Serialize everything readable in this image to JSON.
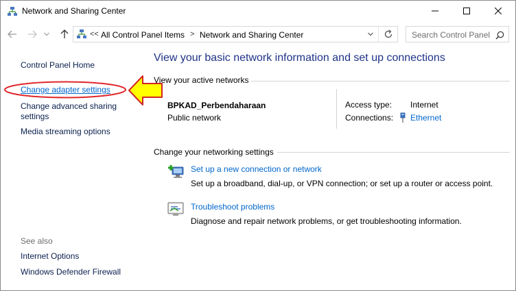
{
  "window": {
    "title": "Network and Sharing Center",
    "icon": "network-center-icon",
    "controls": [
      "minimize-icon",
      "maximize-icon",
      "close-icon"
    ]
  },
  "navigation": {
    "breadcrumb_overflow": "<<",
    "breadcrumb": [
      "All Control Panel Items",
      "Network and Sharing Center"
    ],
    "breadcrumb_separator": ">",
    "search_placeholder": "Search Control Panel"
  },
  "sidebar": {
    "home": "Control Panel Home",
    "links": [
      "Change adapter settings",
      "Change advanced sharing settings",
      "Media streaming options"
    ],
    "see_also_label": "See also",
    "see_also": [
      "Internet Options",
      "Windows Defender Firewall"
    ],
    "annotation_colors": {
      "ellipse": "#e0262a",
      "arrow_fill": "#ffff00",
      "arrow_stroke": "#d12424"
    }
  },
  "main": {
    "heading": "View your basic network information and set up connections",
    "active_networks_label": "View your active networks",
    "network": {
      "name": "BPKAD_Perbendaharaan",
      "type": "Public network",
      "access_type_label": "Access type:",
      "access_type_value": "Internet",
      "connections_label": "Connections:",
      "connections_value": "Ethernet"
    },
    "change_settings_label": "Change your networking settings",
    "tasks": [
      {
        "link": "Set up a new connection or network",
        "description": "Set up a broadband, dial-up, or VPN connection; or set up a router or access point."
      },
      {
        "link": "Troubleshoot problems",
        "description": "Diagnose and repair network problems, or get troubleshooting information."
      }
    ]
  },
  "colors": {
    "heading": "#1e3287",
    "link": "#0066cc",
    "nav_text": "#0a1f4d"
  }
}
